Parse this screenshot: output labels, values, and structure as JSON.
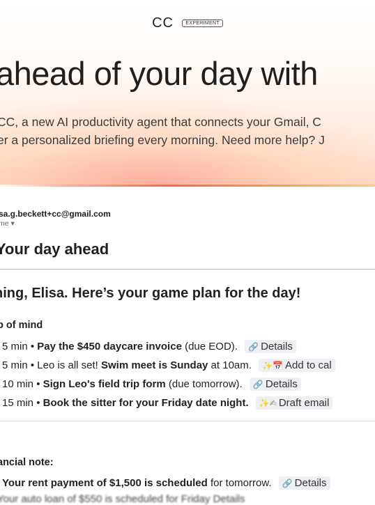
{
  "app": {
    "logo": "CC",
    "badge": "EXPERIMENT"
  },
  "hero": {
    "headline": "ahead of your day with",
    "intro_line1": "CC, a new AI productivity agent that connects your Gmail, C",
    "intro_line2": "er a personalized briefing every morning. Need more help? J"
  },
  "email": {
    "from": "sa.g.beckett+cc@gmail.com",
    "to_label": "me",
    "section_title": "Your day ahead",
    "greeting": "ning, Elisa. Here’s your game plan for the day!",
    "top_of_mind_label": "p of mind",
    "items": [
      {
        "time": "5 min • ",
        "bold": "Pay the $450 daycare invoice",
        "rest": " (due EOD).",
        "chip_icon": "🔗",
        "chip": "Details"
      },
      {
        "time": "5 min • ",
        "pre": "Leo is all set! ",
        "bold": "Swim meet is Sunday",
        "rest": " at 10am.",
        "chip_icon": "✨📅",
        "chip": "Add to cal"
      },
      {
        "time": "10 min • ",
        "bold": "Sign Leo's field trip form",
        "rest": " (due tomorrow).",
        "chip_icon": "🔗",
        "chip": "Details"
      },
      {
        "time": "15 min • ",
        "bold": "Book the sitter for your Friday date night.",
        "rest": "",
        "chip_icon": "✨✍",
        "chip": "Draft email"
      }
    ],
    "section2_letter": "l",
    "financial_label": "ancial note:",
    "financial_items": [
      {
        "bold": "Your rent payment of $1,500 is scheduled",
        "rest": " for tomorrow.",
        "chip_icon": "🔗",
        "chip": "Details"
      }
    ],
    "cut_line": "Your auto loan of $550 is scheduled for Friday   Details"
  },
  "colors": {
    "accent_coral": "#f06a4f",
    "accent_gold": "#f2a24b",
    "chip_bg": "#eef0f3"
  }
}
